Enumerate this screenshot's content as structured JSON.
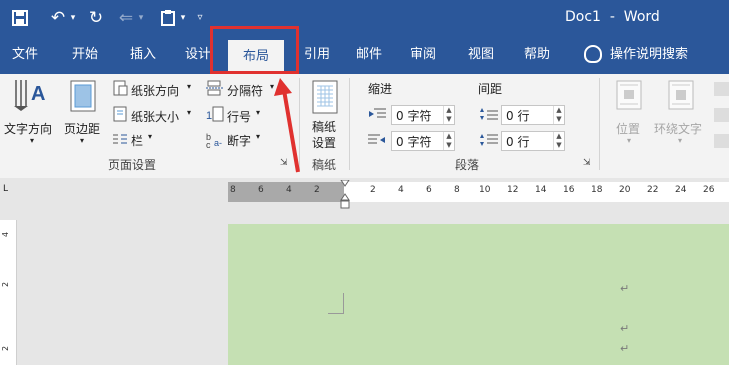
{
  "window": {
    "title": "Doc1  -  Word"
  },
  "quick_access": {
    "save_icon": "save-icon",
    "undo_icon": "undo-icon",
    "redo_icon": "redo-icon",
    "paste_icon": "paste-icon",
    "customize_icon": "customize-qat-icon"
  },
  "tabs": [
    {
      "label": "文件"
    },
    {
      "label": "开始"
    },
    {
      "label": "插入"
    },
    {
      "label": "设计"
    },
    {
      "label": "布局",
      "active": true
    },
    {
      "label": "引用"
    },
    {
      "label": "邮件"
    },
    {
      "label": "审阅"
    },
    {
      "label": "视图"
    },
    {
      "label": "帮助"
    }
  ],
  "tell_me": {
    "label": "操作说明搜索"
  },
  "ribbon": {
    "page_setup": {
      "text_direction": "文字方向",
      "margins": "页边距",
      "orientation": "纸张方向",
      "size": "纸张大小",
      "columns": "栏",
      "breaks": "分隔符",
      "line_numbers": "行号",
      "hyphenation": "断字",
      "group_label": "页面设置"
    },
    "manuscript": {
      "button_line1": "稿纸",
      "button_line2": "设置",
      "group_label": "稿纸"
    },
    "paragraph": {
      "indent_header": "缩进",
      "spacing_header": "间距",
      "indent_left_value": "0 字符",
      "indent_right_value": "0 字符",
      "spacing_before_value": "0 行",
      "spacing_after_value": "0 行",
      "group_label": "段落"
    },
    "arrange": {
      "position": "位置",
      "wrap_text": "环绕文字"
    }
  },
  "ruler": {
    "horizontal_ticks": [
      "8",
      "6",
      "4",
      "2",
      "2",
      "4",
      "6",
      "8",
      "10",
      "12",
      "14",
      "16",
      "18",
      "20",
      "22",
      "24",
      "26"
    ],
    "vertical_ticks": [
      "4",
      "2",
      "2"
    ]
  },
  "colors": {
    "title_bar": "#2b579a",
    "ribbon_bg": "#f3f3f3",
    "page_bg": "#c5e0b3",
    "annotation_red": "#e0312f"
  }
}
